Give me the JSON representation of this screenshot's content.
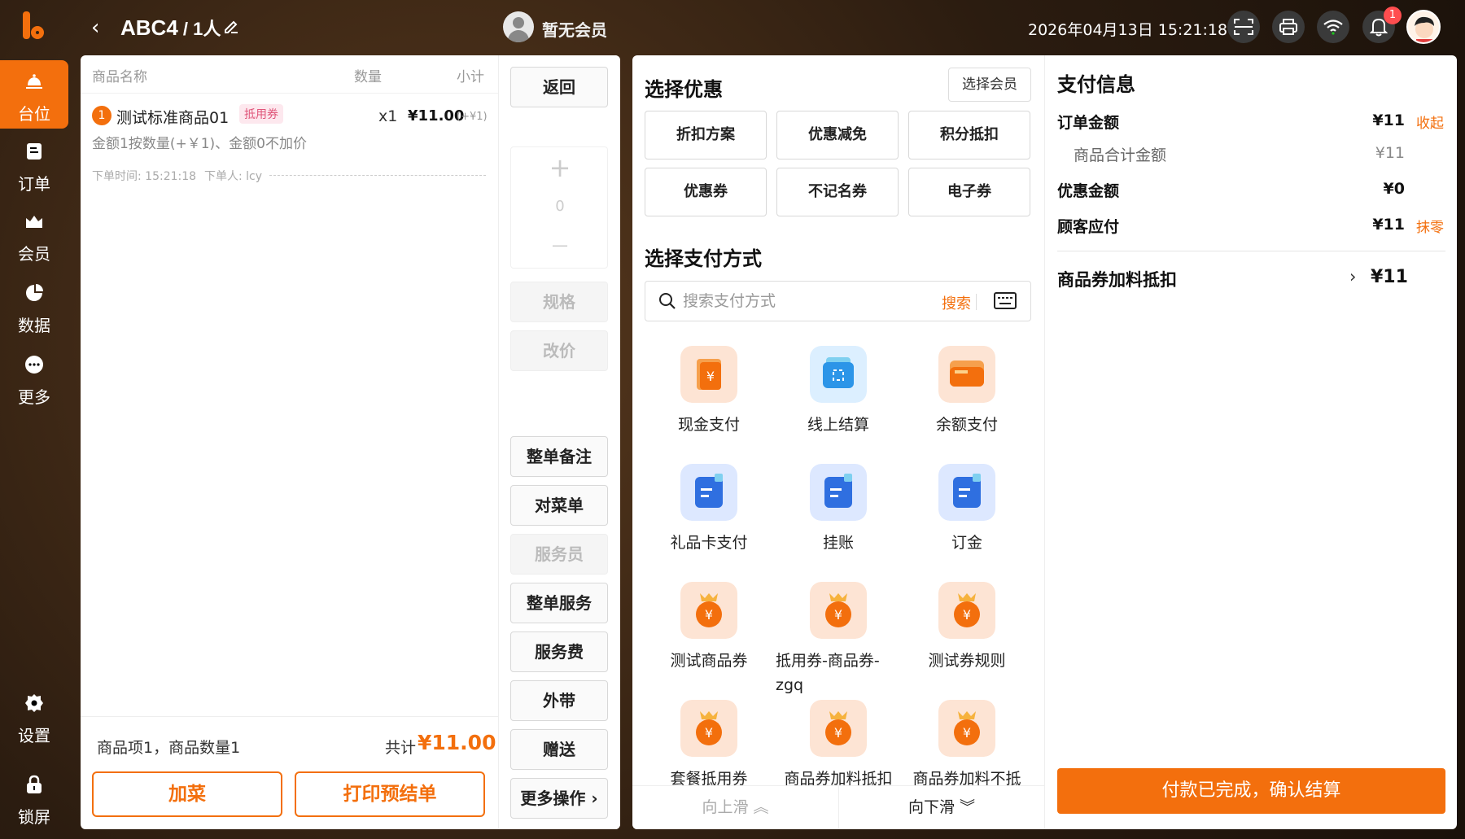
{
  "header": {
    "table": "ABC4",
    "people": " / 1人",
    "member": "暂无会员",
    "datetime": "2026年04月13日 15:21:18",
    "notification_count": "1"
  },
  "nav": {
    "items": [
      {
        "label": "台位",
        "active": true
      },
      {
        "label": "订单"
      },
      {
        "label": "会员"
      },
      {
        "label": "数据"
      },
      {
        "label": "更多"
      },
      {
        "label": "设置"
      },
      {
        "label": "锁屏"
      }
    ]
  },
  "order": {
    "col_name": "商品名称",
    "col_qty": "数量",
    "col_subtotal": "小计",
    "item": {
      "index": "1",
      "name": "测试标准商品01",
      "tag": "抵用券",
      "qty": "x1",
      "price": "¥11.00",
      "extra": "(+¥1)",
      "rule": "金额1按数量(+￥1)、金额0不加价"
    },
    "order_time": "下单时间: 15:21:18",
    "orderer": "下单人: lcy",
    "summary": "商品项1，商品数量1",
    "total_label": "共计",
    "total_value": "¥11.00",
    "add_btn": "加菜",
    "print_btn": "打印预结单"
  },
  "actions": {
    "back": "返回",
    "stepper_plus": "+",
    "stepper_value": "0",
    "stepper_minus": "—",
    "spec": "规格",
    "change_price": "改价",
    "order_note": "整单备注",
    "check_menu": "对菜单",
    "waiter": "服务员",
    "order_service": "整单服务",
    "service_fee": "服务费",
    "takeaway": "外带",
    "gift": "赠送",
    "more": "更多操作 ›"
  },
  "discount": {
    "title": "选择优惠",
    "select_member": "选择会员",
    "buttons": [
      "折扣方案",
      "优惠减免",
      "积分抵扣",
      "优惠券",
      "不记名券",
      "电子券"
    ]
  },
  "payment": {
    "title": "选择支付方式",
    "search_placeholder": "搜索支付方式",
    "search_btn": "搜索",
    "methods": [
      "现金支付",
      "线上结算",
      "余额支付",
      "礼品卡支付",
      "挂账",
      "订金",
      "测试商品券",
      "抵用券-商品券-zgq",
      "测试券规则",
      "套餐抵用券",
      "商品券加料抵扣",
      "商品券加料不抵"
    ],
    "scroll_up": "向上滑 ︽",
    "scroll_down": "向下滑 ︾"
  },
  "pay_info": {
    "title": "支付信息",
    "order_amount_label": "订单金额",
    "order_amount": "¥11",
    "collapse": "收起",
    "goods_total_label": "商品合计金额",
    "goods_total": "¥11",
    "discount_label": "优惠金额",
    "discount": "¥0",
    "payable_label": "顾客应付",
    "payable": "¥11",
    "round_off": "抹零",
    "coupon_label": "商品券加料抵扣",
    "coupon_value": "¥11",
    "confirm": "付款已完成，确认结算"
  },
  "colors": {
    "accent": "#f36f0d",
    "tag": "#e0567a"
  }
}
